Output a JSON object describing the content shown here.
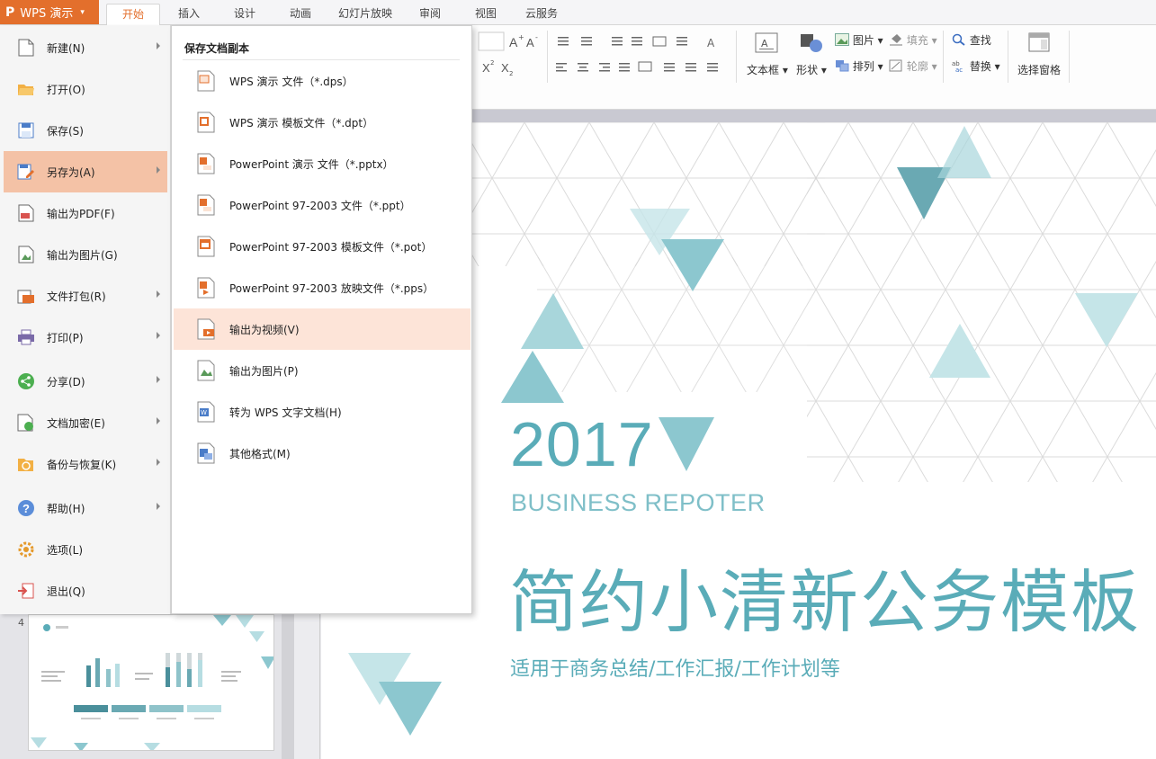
{
  "app": {
    "name": "WPS 演示"
  },
  "tabs": [
    "开始",
    "插入",
    "设计",
    "动画",
    "幻灯片放映",
    "审阅",
    "视图",
    "云服务"
  ],
  "ribbon": {
    "textbox_label": "文本框",
    "shape_label": "形状",
    "picture_label": "图片",
    "fill_label": "填充",
    "arrange_label": "排列",
    "outline_label": "轮廓",
    "find_label": "查找",
    "replace_label": "替换",
    "selection_pane_label": "选择窗格"
  },
  "file_menu": {
    "items": [
      {
        "label": "新建(N)",
        "icon": "new-doc-icon",
        "has_submenu": true
      },
      {
        "label": "打开(O)",
        "icon": "folder-open-icon",
        "has_submenu": false
      },
      {
        "label": "保存(S)",
        "icon": "save-icon",
        "has_submenu": false
      },
      {
        "label": "另存为(A)",
        "icon": "save-as-icon",
        "has_submenu": true,
        "selected": true
      },
      {
        "label": "输出为PDF(F)",
        "icon": "pdf-icon",
        "has_submenu": false
      },
      {
        "label": "输出为图片(G)",
        "icon": "image-export-icon",
        "has_submenu": false
      },
      {
        "label": "文件打包(R)",
        "icon": "package-icon",
        "has_submenu": true
      },
      {
        "label": "打印(P)",
        "icon": "printer-icon",
        "has_submenu": true
      },
      {
        "label": "分享(D)",
        "icon": "share-icon",
        "has_submenu": true
      },
      {
        "label": "文档加密(E)",
        "icon": "encrypt-icon",
        "has_submenu": true
      },
      {
        "label": "备份与恢复(K)",
        "icon": "backup-icon",
        "has_submenu": true
      },
      {
        "label": "帮助(H)",
        "icon": "help-icon",
        "has_submenu": true
      },
      {
        "label": "选项(L)",
        "icon": "gear-icon",
        "has_submenu": false
      },
      {
        "label": "退出(Q)",
        "icon": "exit-icon",
        "has_submenu": false
      }
    ]
  },
  "save_as_menu": {
    "title": "保存文档副本",
    "items": [
      {
        "label": "WPS 演示 文件（*.dps）",
        "icon": "dps-file-icon"
      },
      {
        "label": "WPS 演示 模板文件（*.dpt）",
        "icon": "dpt-file-icon"
      },
      {
        "label": "PowerPoint 演示 文件（*.pptx）",
        "icon": "pptx-file-icon"
      },
      {
        "label": "PowerPoint 97-2003 文件（*.ppt）",
        "icon": "ppt-file-icon"
      },
      {
        "label": "PowerPoint 97-2003 模板文件（*.pot）",
        "icon": "pot-file-icon"
      },
      {
        "label": "PowerPoint 97-2003 放映文件（*.pps）",
        "icon": "pps-file-icon"
      },
      {
        "label": "输出为视频(V)",
        "icon": "video-export-icon",
        "selected": true
      },
      {
        "label": "输出为图片(P)",
        "icon": "image-export-icon"
      },
      {
        "label": "转为 WPS 文字文档(H)",
        "icon": "wps-writer-icon"
      },
      {
        "label": "其他格式(M)",
        "icon": "other-format-icon"
      }
    ]
  },
  "thumbnail": {
    "number": "4"
  },
  "slide": {
    "year": "2017",
    "subtitle": "BUSINESS REPOTER",
    "title": "简约小清新公务模板",
    "description": "适用于商务总结/工作汇报/工作计划等"
  },
  "colors": {
    "accent": "#e36f2c",
    "teal": "#5aacb8",
    "menu_selected": "#f4c2a6",
    "submenu_selected": "#fde4d8"
  }
}
